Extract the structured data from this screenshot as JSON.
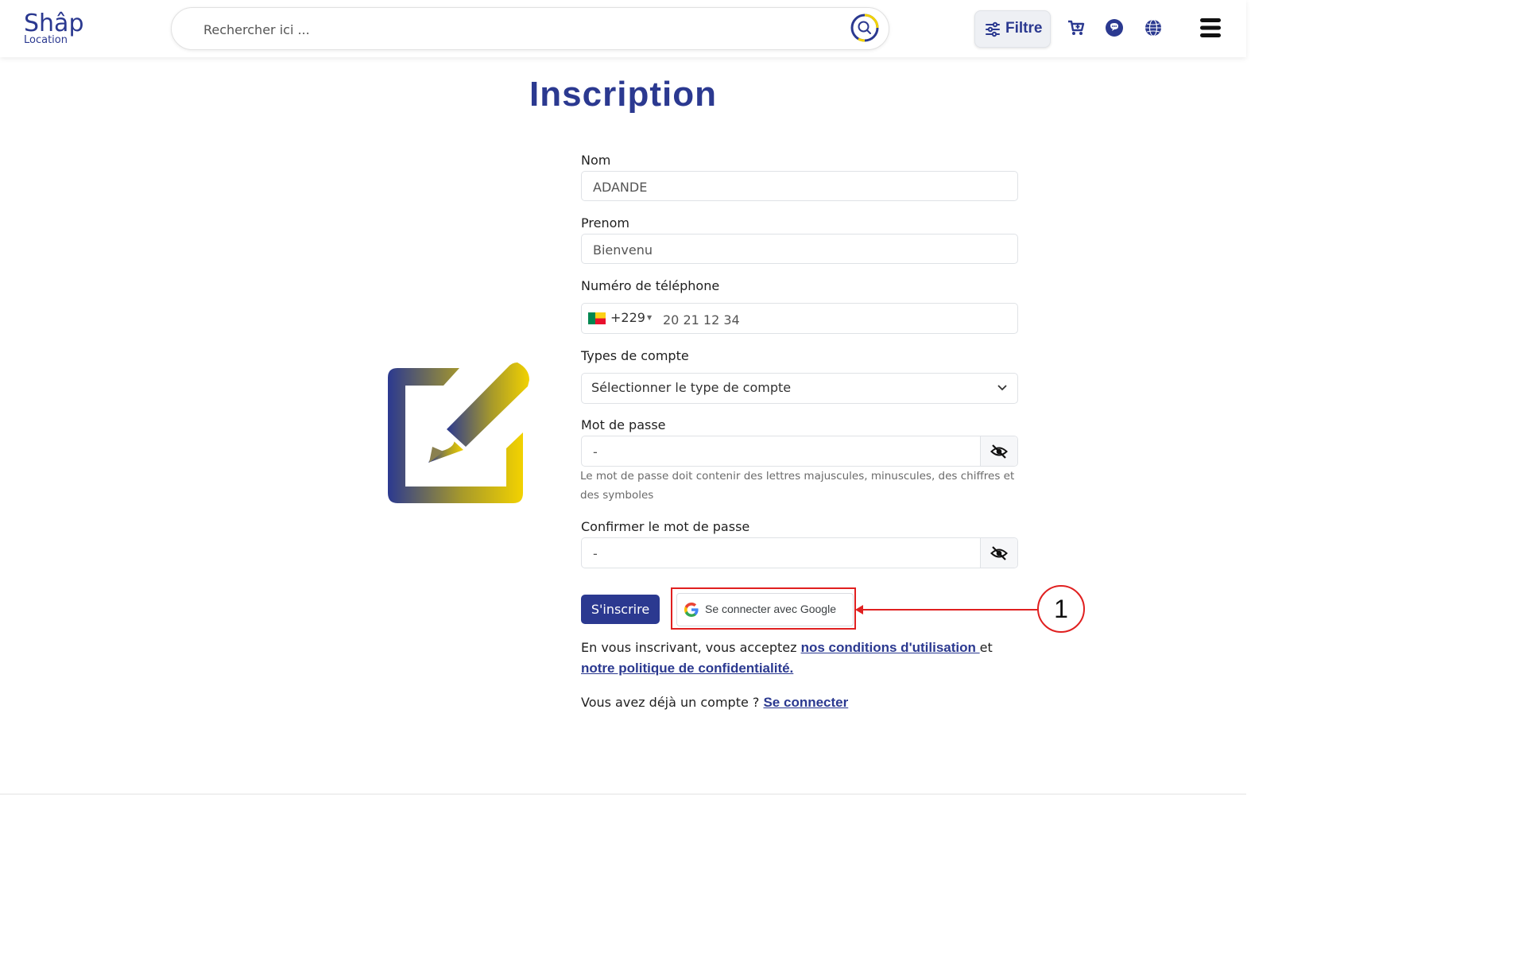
{
  "header": {
    "logo_main": "Shâp",
    "logo_sub": "Location",
    "search_placeholder": "Rechercher ici ...",
    "filter_label": "Filtre"
  },
  "icons": {
    "search": "search-icon",
    "filter": "sliders-icon",
    "cart": "cart-icon",
    "chat": "chat-icon",
    "language": "globe-icon",
    "menu": "hamburger-icon",
    "eye": "eye-off-icon",
    "google": "google-icon",
    "hero": "edit-square-icon"
  },
  "page": {
    "title": "Inscription"
  },
  "form": {
    "nom": {
      "label": "Nom",
      "value": "ADANDE"
    },
    "prenom": {
      "label": "Prenom",
      "value": "Bienvenu"
    },
    "phone": {
      "label": "Numéro de téléphone",
      "country_code": "+229",
      "value": "20 21 12 34"
    },
    "account_type": {
      "label": "Types de compte",
      "selected": "Sélectionner le type de compte"
    },
    "password": {
      "label": "Mot de passe",
      "value": "-",
      "hint": "Le mot de passe doit contenir des lettres majuscules, minuscules, des chiffres et des symboles"
    },
    "confirm_password": {
      "label": "Confirmer le mot de passe",
      "value": "-"
    },
    "submit_label": "S'inscrire",
    "google_label": "Se connecter avec Google"
  },
  "terms": {
    "prefix": "En vous inscrivant, vous acceptez ",
    "conditions_link": "nos conditions d'utilisation ",
    "middle": "et",
    "privacy_link": "notre politique de confidentialité.",
    "login_prefix": "Vous avez déjà un compte ? ",
    "login_link": "Se connecter"
  },
  "annotation": {
    "number": "1"
  },
  "colors": {
    "brand": "#2b3990",
    "accent_yellow": "#f2d200",
    "annotation": "#e02020"
  }
}
